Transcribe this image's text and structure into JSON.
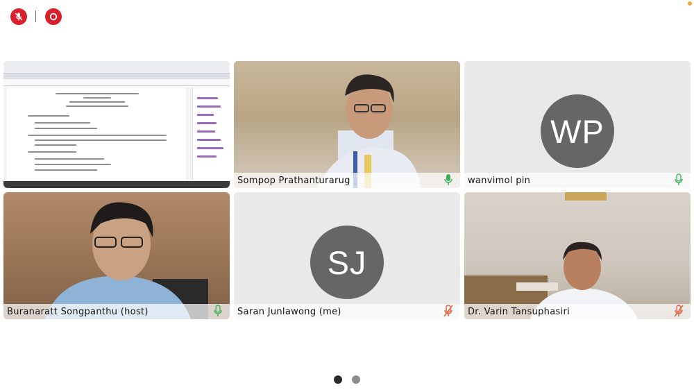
{
  "toolbar": {
    "mute_button": "mic-off-icon",
    "record_button": "record-icon"
  },
  "tiles": [
    {
      "id": "shared-screen",
      "type": "screen-share"
    },
    {
      "id": "sompop",
      "name": "Sompop Prathanturarug",
      "type": "video",
      "active_speaker": true,
      "mic": "on",
      "mic_color": "#3ab05b"
    },
    {
      "id": "wanvimol",
      "name": "wanvimol pin",
      "type": "avatar",
      "initials": "WP",
      "mic": "on",
      "mic_color": "#3ab05b"
    },
    {
      "id": "buranaratt",
      "name": "Buranaratt Songpanthu (host)",
      "type": "video",
      "mic": "on",
      "mic_color": "#3ab05b"
    },
    {
      "id": "saran",
      "name": "Saran Junlawong (me)",
      "type": "avatar",
      "initials": "SJ",
      "mic": "muted",
      "mic_color": "#e0603a"
    },
    {
      "id": "varin",
      "name": "Dr. Varin Tansuphasiri",
      "type": "video",
      "mic": "muted",
      "mic_color": "#e0603a"
    }
  ],
  "pager": {
    "pages": 2,
    "current": 1
  },
  "colors": {
    "control_red": "#d81f2b",
    "active_border": "#40c1b1",
    "avatar_grey": "#666666",
    "mic_on": "#3ab05b",
    "mic_muted": "#e0603a"
  }
}
